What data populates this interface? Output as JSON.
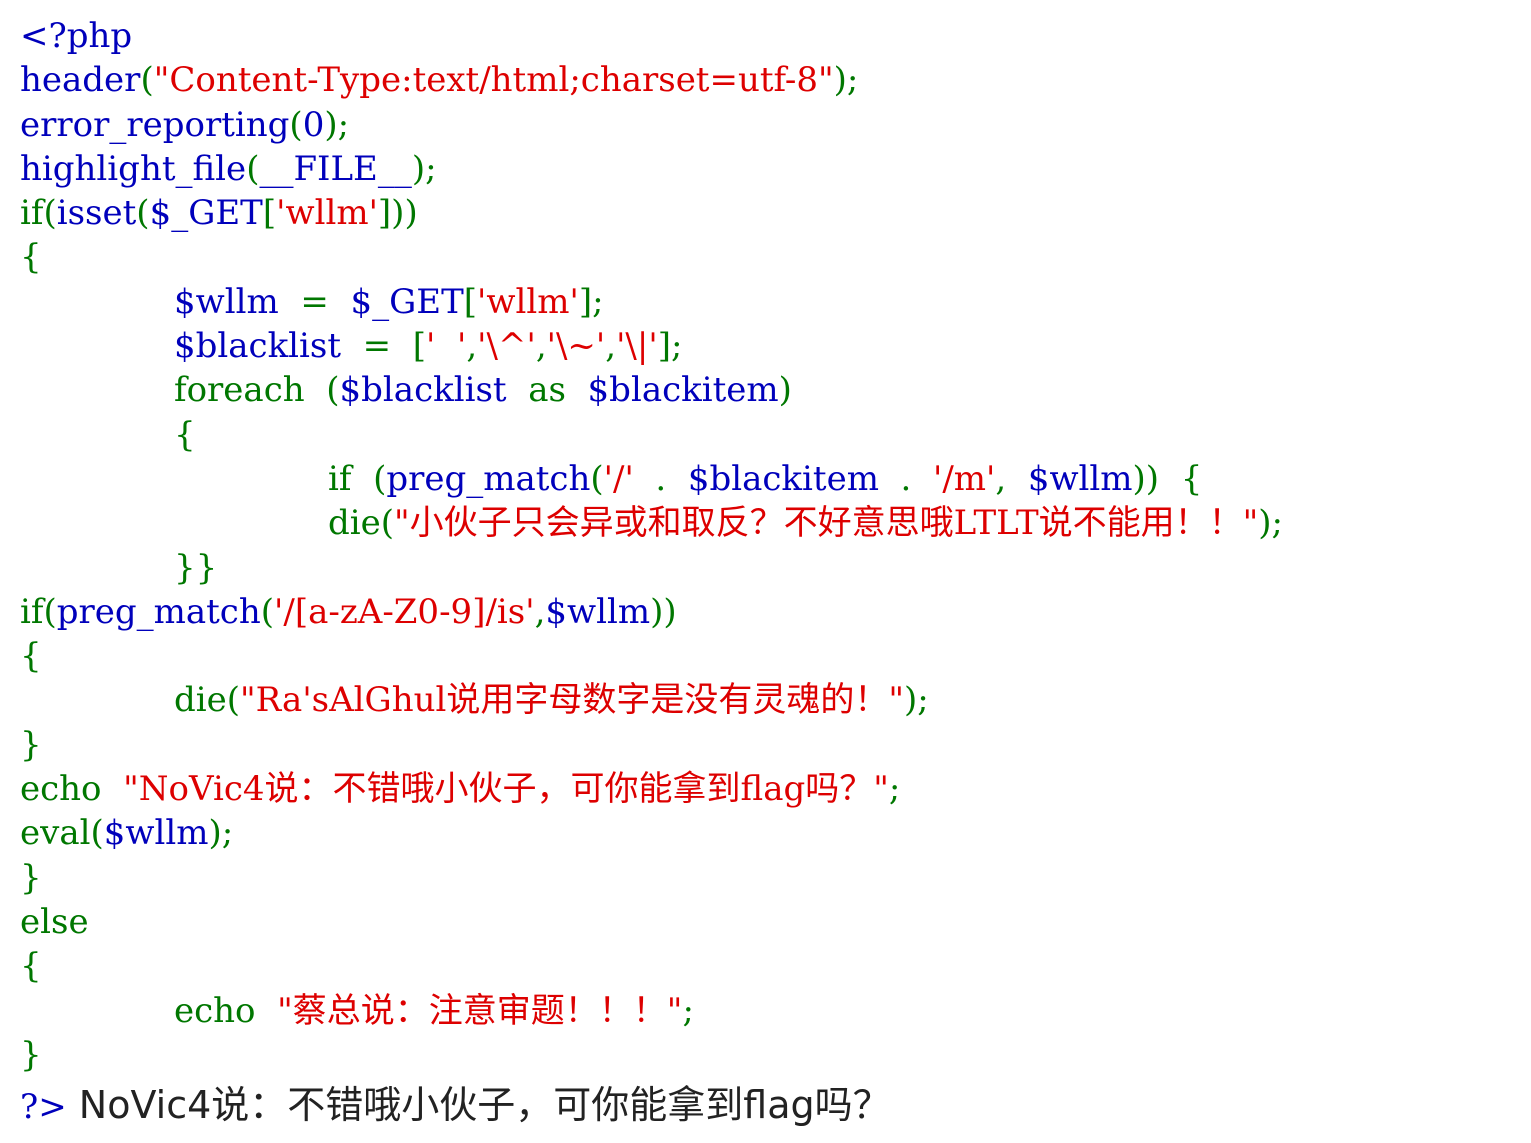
{
  "code": {
    "lines": [
      [
        {
          "c": "def",
          "t": "<?php"
        }
      ],
      [
        {
          "c": "def",
          "t": "header"
        },
        {
          "c": "kw",
          "t": "("
        },
        {
          "c": "str",
          "t": "\"Content-Type:text/html;charset=utf-8\""
        },
        {
          "c": "kw",
          "t": ");"
        }
      ],
      [
        {
          "c": "def",
          "t": "error_reporting"
        },
        {
          "c": "kw",
          "t": "("
        },
        {
          "c": "def",
          "t": "0"
        },
        {
          "c": "kw",
          "t": ");"
        }
      ],
      [
        {
          "c": "def",
          "t": "highlight_file"
        },
        {
          "c": "kw",
          "t": "("
        },
        {
          "c": "def",
          "t": "__FILE__"
        },
        {
          "c": "kw",
          "t": ");"
        }
      ],
      [
        {
          "c": "kw",
          "t": "if("
        },
        {
          "c": "def",
          "t": "isset"
        },
        {
          "c": "kw",
          "t": "("
        },
        {
          "c": "def",
          "t": "$_GET"
        },
        {
          "c": "kw",
          "t": "["
        },
        {
          "c": "str",
          "t": "'wllm'"
        },
        {
          "c": "kw",
          "t": "]))"
        }
      ],
      [
        {
          "c": "kw",
          "t": "{"
        }
      ],
      [
        {
          "i": 1
        },
        {
          "c": "def",
          "t": "$wllm  "
        },
        {
          "c": "kw",
          "t": "=  "
        },
        {
          "c": "def",
          "t": "$_GET"
        },
        {
          "c": "kw",
          "t": "["
        },
        {
          "c": "str",
          "t": "'wllm'"
        },
        {
          "c": "kw",
          "t": "];"
        }
      ],
      [
        {
          "i": 1
        },
        {
          "c": "def",
          "t": "$blacklist  "
        },
        {
          "c": "kw",
          "t": "=  ["
        },
        {
          "c": "str",
          "t": "'  '"
        },
        {
          "c": "kw",
          "t": ","
        },
        {
          "c": "str",
          "t": "'\\^'"
        },
        {
          "c": "kw",
          "t": ","
        },
        {
          "c": "str",
          "t": "'\\~'"
        },
        {
          "c": "kw",
          "t": ","
        },
        {
          "c": "str",
          "t": "'\\|'"
        },
        {
          "c": "kw",
          "t": "];"
        }
      ],
      [
        {
          "i": 1
        },
        {
          "c": "kw",
          "t": "foreach  ("
        },
        {
          "c": "def",
          "t": "$blacklist  "
        },
        {
          "c": "kw",
          "t": "as  "
        },
        {
          "c": "def",
          "t": "$blackitem"
        },
        {
          "c": "kw",
          "t": ")"
        }
      ],
      [
        {
          "i": 1
        },
        {
          "c": "kw",
          "t": "{"
        }
      ],
      [
        {
          "i": 2
        },
        {
          "c": "kw",
          "t": "if  ("
        },
        {
          "c": "def",
          "t": "preg_match"
        },
        {
          "c": "kw",
          "t": "("
        },
        {
          "c": "str",
          "t": "'/'  "
        },
        {
          "c": "kw",
          "t": ".  "
        },
        {
          "c": "def",
          "t": "$blackitem  "
        },
        {
          "c": "kw",
          "t": ".  "
        },
        {
          "c": "str",
          "t": "'/m'"
        },
        {
          "c": "kw",
          "t": ",  "
        },
        {
          "c": "def",
          "t": "$wllm"
        },
        {
          "c": "kw",
          "t": "))  {"
        }
      ],
      [
        {
          "i": 2
        },
        {
          "c": "kw",
          "t": "die("
        },
        {
          "c": "str",
          "t": "\"小伙子只会异或和取反？不好意思哦LTLT说不能用！！\""
        },
        {
          "c": "kw",
          "t": ");"
        }
      ],
      [
        {
          "i": 1
        },
        {
          "c": "kw",
          "t": "}}"
        }
      ],
      [
        {
          "c": "kw",
          "t": "if("
        },
        {
          "c": "def",
          "t": "preg_match"
        },
        {
          "c": "kw",
          "t": "("
        },
        {
          "c": "str",
          "t": "'/[a-zA-Z0-9]/is'"
        },
        {
          "c": "kw",
          "t": ","
        },
        {
          "c": "def",
          "t": "$wllm"
        },
        {
          "c": "kw",
          "t": "))"
        }
      ],
      [
        {
          "c": "kw",
          "t": "{"
        }
      ],
      [
        {
          "i": 1
        },
        {
          "c": "kw",
          "t": "die("
        },
        {
          "c": "str",
          "t": "\"Ra'sAlGhul说用字母数字是没有灵魂的！\""
        },
        {
          "c": "kw",
          "t": ");"
        }
      ],
      [
        {
          "c": "kw",
          "t": "}"
        }
      ],
      [
        {
          "c": "kw",
          "t": "echo  "
        },
        {
          "c": "str",
          "t": "\"NoVic4说：不错哦小伙子，可你能拿到flag吗？\""
        },
        {
          "c": "kw",
          "t": ";"
        }
      ],
      [
        {
          "c": "kw",
          "t": "eval("
        },
        {
          "c": "def",
          "t": "$wllm"
        },
        {
          "c": "kw",
          "t": ");"
        }
      ],
      [
        {
          "c": "kw",
          "t": "}"
        }
      ],
      [
        {
          "c": "kw",
          "t": "else"
        }
      ],
      [
        {
          "c": "kw",
          "t": "{"
        }
      ],
      [
        {
          "i": 1
        },
        {
          "c": "kw",
          "t": "echo  "
        },
        {
          "c": "str",
          "t": "\"蔡总说：注意审题！！！\""
        },
        {
          "c": "kw",
          "t": ";"
        }
      ],
      [
        {
          "c": "kw",
          "t": "}"
        }
      ]
    ]
  },
  "output": {
    "php_close": "?>",
    "text": " NoVic4说：不错哦小伙子，可你能拿到flag吗？"
  },
  "colors": {
    "default": "#0000BB",
    "keyword": "#007700",
    "string": "#DD0000",
    "html_text": "#222222",
    "background": "#FFFFFF"
  }
}
